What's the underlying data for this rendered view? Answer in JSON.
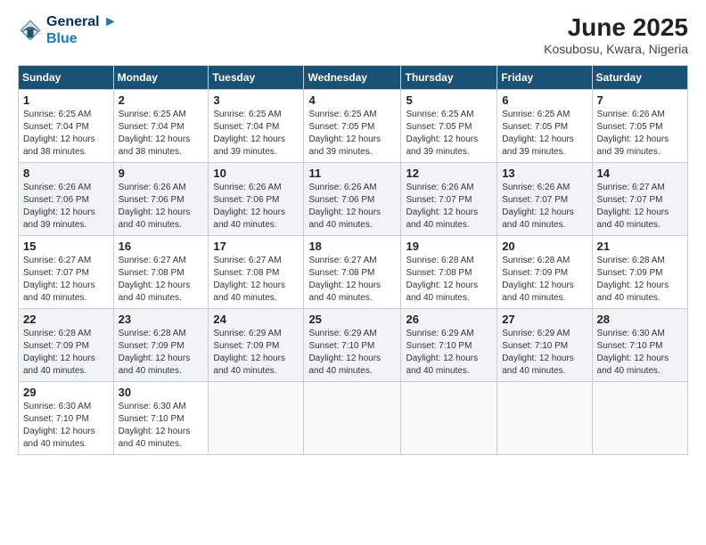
{
  "header": {
    "logo_line1": "General",
    "logo_line2": "Blue",
    "month_title": "June 2025",
    "location": "Kosubosu, Kwara, Nigeria"
  },
  "days_of_week": [
    "Sunday",
    "Monday",
    "Tuesday",
    "Wednesday",
    "Thursday",
    "Friday",
    "Saturday"
  ],
  "weeks": [
    [
      {
        "day": "1",
        "sunrise": "6:25 AM",
        "sunset": "7:04 PM",
        "daylight": "12 hours and 38 minutes."
      },
      {
        "day": "2",
        "sunrise": "6:25 AM",
        "sunset": "7:04 PM",
        "daylight": "12 hours and 38 minutes."
      },
      {
        "day": "3",
        "sunrise": "6:25 AM",
        "sunset": "7:04 PM",
        "daylight": "12 hours and 39 minutes."
      },
      {
        "day": "4",
        "sunrise": "6:25 AM",
        "sunset": "7:05 PM",
        "daylight": "12 hours and 39 minutes."
      },
      {
        "day": "5",
        "sunrise": "6:25 AM",
        "sunset": "7:05 PM",
        "daylight": "12 hours and 39 minutes."
      },
      {
        "day": "6",
        "sunrise": "6:25 AM",
        "sunset": "7:05 PM",
        "daylight": "12 hours and 39 minutes."
      },
      {
        "day": "7",
        "sunrise": "6:26 AM",
        "sunset": "7:05 PM",
        "daylight": "12 hours and 39 minutes."
      }
    ],
    [
      {
        "day": "8",
        "sunrise": "6:26 AM",
        "sunset": "7:06 PM",
        "daylight": "12 hours and 39 minutes."
      },
      {
        "day": "9",
        "sunrise": "6:26 AM",
        "sunset": "7:06 PM",
        "daylight": "12 hours and 40 minutes."
      },
      {
        "day": "10",
        "sunrise": "6:26 AM",
        "sunset": "7:06 PM",
        "daylight": "12 hours and 40 minutes."
      },
      {
        "day": "11",
        "sunrise": "6:26 AM",
        "sunset": "7:06 PM",
        "daylight": "12 hours and 40 minutes."
      },
      {
        "day": "12",
        "sunrise": "6:26 AM",
        "sunset": "7:07 PM",
        "daylight": "12 hours and 40 minutes."
      },
      {
        "day": "13",
        "sunrise": "6:26 AM",
        "sunset": "7:07 PM",
        "daylight": "12 hours and 40 minutes."
      },
      {
        "day": "14",
        "sunrise": "6:27 AM",
        "sunset": "7:07 PM",
        "daylight": "12 hours and 40 minutes."
      }
    ],
    [
      {
        "day": "15",
        "sunrise": "6:27 AM",
        "sunset": "7:07 PM",
        "daylight": "12 hours and 40 minutes."
      },
      {
        "day": "16",
        "sunrise": "6:27 AM",
        "sunset": "7:08 PM",
        "daylight": "12 hours and 40 minutes."
      },
      {
        "day": "17",
        "sunrise": "6:27 AM",
        "sunset": "7:08 PM",
        "daylight": "12 hours and 40 minutes."
      },
      {
        "day": "18",
        "sunrise": "6:27 AM",
        "sunset": "7:08 PM",
        "daylight": "12 hours and 40 minutes."
      },
      {
        "day": "19",
        "sunrise": "6:28 AM",
        "sunset": "7:08 PM",
        "daylight": "12 hours and 40 minutes."
      },
      {
        "day": "20",
        "sunrise": "6:28 AM",
        "sunset": "7:09 PM",
        "daylight": "12 hours and 40 minutes."
      },
      {
        "day": "21",
        "sunrise": "6:28 AM",
        "sunset": "7:09 PM",
        "daylight": "12 hours and 40 minutes."
      }
    ],
    [
      {
        "day": "22",
        "sunrise": "6:28 AM",
        "sunset": "7:09 PM",
        "daylight": "12 hours and 40 minutes."
      },
      {
        "day": "23",
        "sunrise": "6:28 AM",
        "sunset": "7:09 PM",
        "daylight": "12 hours and 40 minutes."
      },
      {
        "day": "24",
        "sunrise": "6:29 AM",
        "sunset": "7:09 PM",
        "daylight": "12 hours and 40 minutes."
      },
      {
        "day": "25",
        "sunrise": "6:29 AM",
        "sunset": "7:10 PM",
        "daylight": "12 hours and 40 minutes."
      },
      {
        "day": "26",
        "sunrise": "6:29 AM",
        "sunset": "7:10 PM",
        "daylight": "12 hours and 40 minutes."
      },
      {
        "day": "27",
        "sunrise": "6:29 AM",
        "sunset": "7:10 PM",
        "daylight": "12 hours and 40 minutes."
      },
      {
        "day": "28",
        "sunrise": "6:30 AM",
        "sunset": "7:10 PM",
        "daylight": "12 hours and 40 minutes."
      }
    ],
    [
      {
        "day": "29",
        "sunrise": "6:30 AM",
        "sunset": "7:10 PM",
        "daylight": "12 hours and 40 minutes."
      },
      {
        "day": "30",
        "sunrise": "6:30 AM",
        "sunset": "7:10 PM",
        "daylight": "12 hours and 40 minutes."
      },
      null,
      null,
      null,
      null,
      null
    ]
  ],
  "labels": {
    "sunrise_prefix": "Sunrise: ",
    "sunset_prefix": "Sunset: ",
    "daylight_prefix": "Daylight: "
  }
}
